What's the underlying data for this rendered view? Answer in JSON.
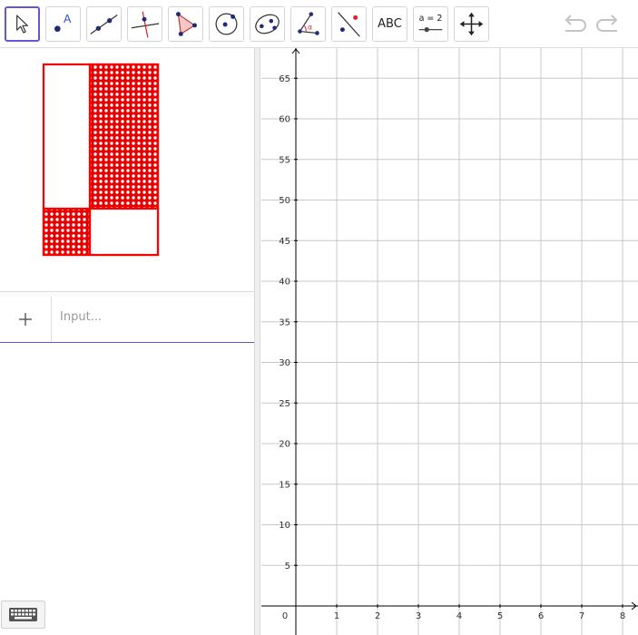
{
  "toolbar": {
    "tools": [
      {
        "name": "move-tool",
        "icon": "arrow-cursor-icon",
        "selected": true
      },
      {
        "name": "point-tool",
        "icon": "point-icon",
        "label": "A"
      },
      {
        "name": "line-tool",
        "icon": "line-icon"
      },
      {
        "name": "perpendicular-line-tool",
        "icon": "perpendicular-line-icon"
      },
      {
        "name": "polygon-tool",
        "icon": "polygon-icon"
      },
      {
        "name": "circle-center-point-tool",
        "icon": "circle-icon"
      },
      {
        "name": "ellipse-tool",
        "icon": "ellipse-icon"
      },
      {
        "name": "angle-tool",
        "icon": "angle-icon",
        "label": "α"
      },
      {
        "name": "reflect-tool",
        "icon": "reflect-icon"
      },
      {
        "name": "text-tool",
        "icon": "text-icon",
        "label": "ABC"
      },
      {
        "name": "slider-tool",
        "icon": "slider-icon",
        "label": "a = 2"
      },
      {
        "name": "move-graphics-view-tool",
        "icon": "move-arrows-icon"
      }
    ],
    "undo_icon": "undo-icon",
    "redo_icon": "redo-icon"
  },
  "algebra": {
    "add_icon": "plus-icon",
    "input_placeholder": "Input...",
    "keyboard_icon": "keyboard-icon"
  },
  "colors": {
    "accent": "#6557d2",
    "shape": "#ff0000",
    "grid": "#c8c8c8",
    "axis": "#000000"
  },
  "graphics": {
    "x_ticks": [
      "1",
      "2",
      "3",
      "4",
      "5",
      "6",
      "7",
      "8"
    ],
    "y_ticks": [
      "5",
      "10",
      "15",
      "20",
      "25",
      "30",
      "35",
      "40",
      "45",
      "50",
      "55",
      "60",
      "65"
    ],
    "origin_label": "0",
    "grid": true
  }
}
